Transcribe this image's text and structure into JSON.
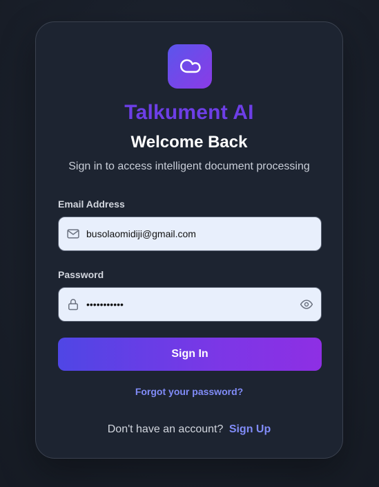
{
  "brand": {
    "name": "Talkument AI",
    "logo_icon": "cloud-icon",
    "logo_gradient": [
      "#5b55ec",
      "#8b3be6"
    ]
  },
  "header": {
    "title": "Welcome Back",
    "subtitle": "Sign in to access intelligent document processing"
  },
  "form": {
    "email": {
      "label": "Email Address",
      "value": "busolaomidiji@gmail.com",
      "icon": "mail-icon"
    },
    "password": {
      "label": "Password",
      "value": "•••••••••••",
      "icon": "lock-icon",
      "toggle_icon": "eye-icon"
    },
    "submit_label": "Sign In",
    "forgot_label": "Forgot your password?"
  },
  "footer": {
    "prompt": "Don't have an account?",
    "signup_label": "Sign Up"
  },
  "colors": {
    "accent": "#818cf8",
    "brand_text": "#6d3ee6",
    "card_bg": "#1d2431",
    "input_bg": "#e8effc"
  }
}
